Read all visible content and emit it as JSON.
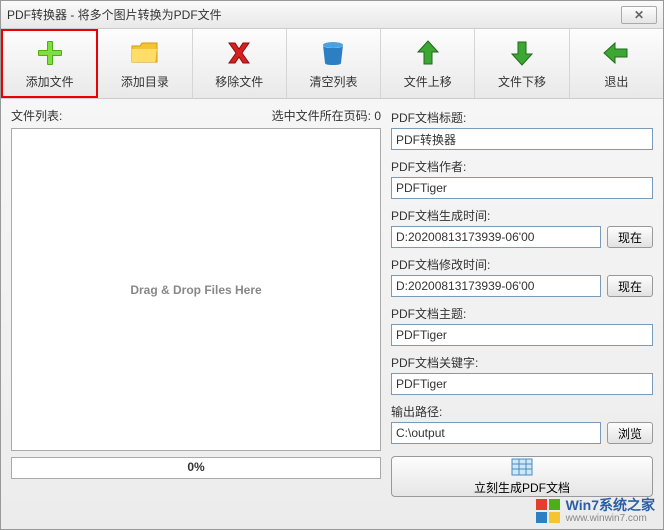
{
  "window": {
    "title": "PDF转换器 - 将多个图片转换为PDF文件"
  },
  "toolbar": {
    "add_file": "添加文件",
    "add_dir": "添加目录",
    "remove": "移除文件",
    "clear": "清空列表",
    "move_up": "文件上移",
    "move_down": "文件下移",
    "exit": "退出"
  },
  "left": {
    "list_label": "文件列表:",
    "page_label": "选中文件所在页码: 0",
    "drop_hint": "Drag & Drop Files Here",
    "progress": "0%"
  },
  "right": {
    "title_label": "PDF文档标题:",
    "title_value": "PDF转换器",
    "author_label": "PDF文档作者:",
    "author_value": "PDFTiger",
    "create_label": "PDF文档生成时间:",
    "create_value": "D:20200813173939-06'00",
    "modify_label": "PDF文档修改时间:",
    "modify_value": "D:20200813173939-06'00",
    "subject_label": "PDF文档主题:",
    "subject_value": "PDFTiger",
    "keywords_label": "PDF文档关键字:",
    "keywords_value": "PDFTiger",
    "output_label": "输出路径:",
    "output_value": "C:\\output",
    "now_btn": "现在",
    "browse_btn": "浏览",
    "generate": "立刻生成PDF文档"
  },
  "watermark": {
    "line1": "Win7系统之家",
    "line2": "www.winwin7.com"
  }
}
